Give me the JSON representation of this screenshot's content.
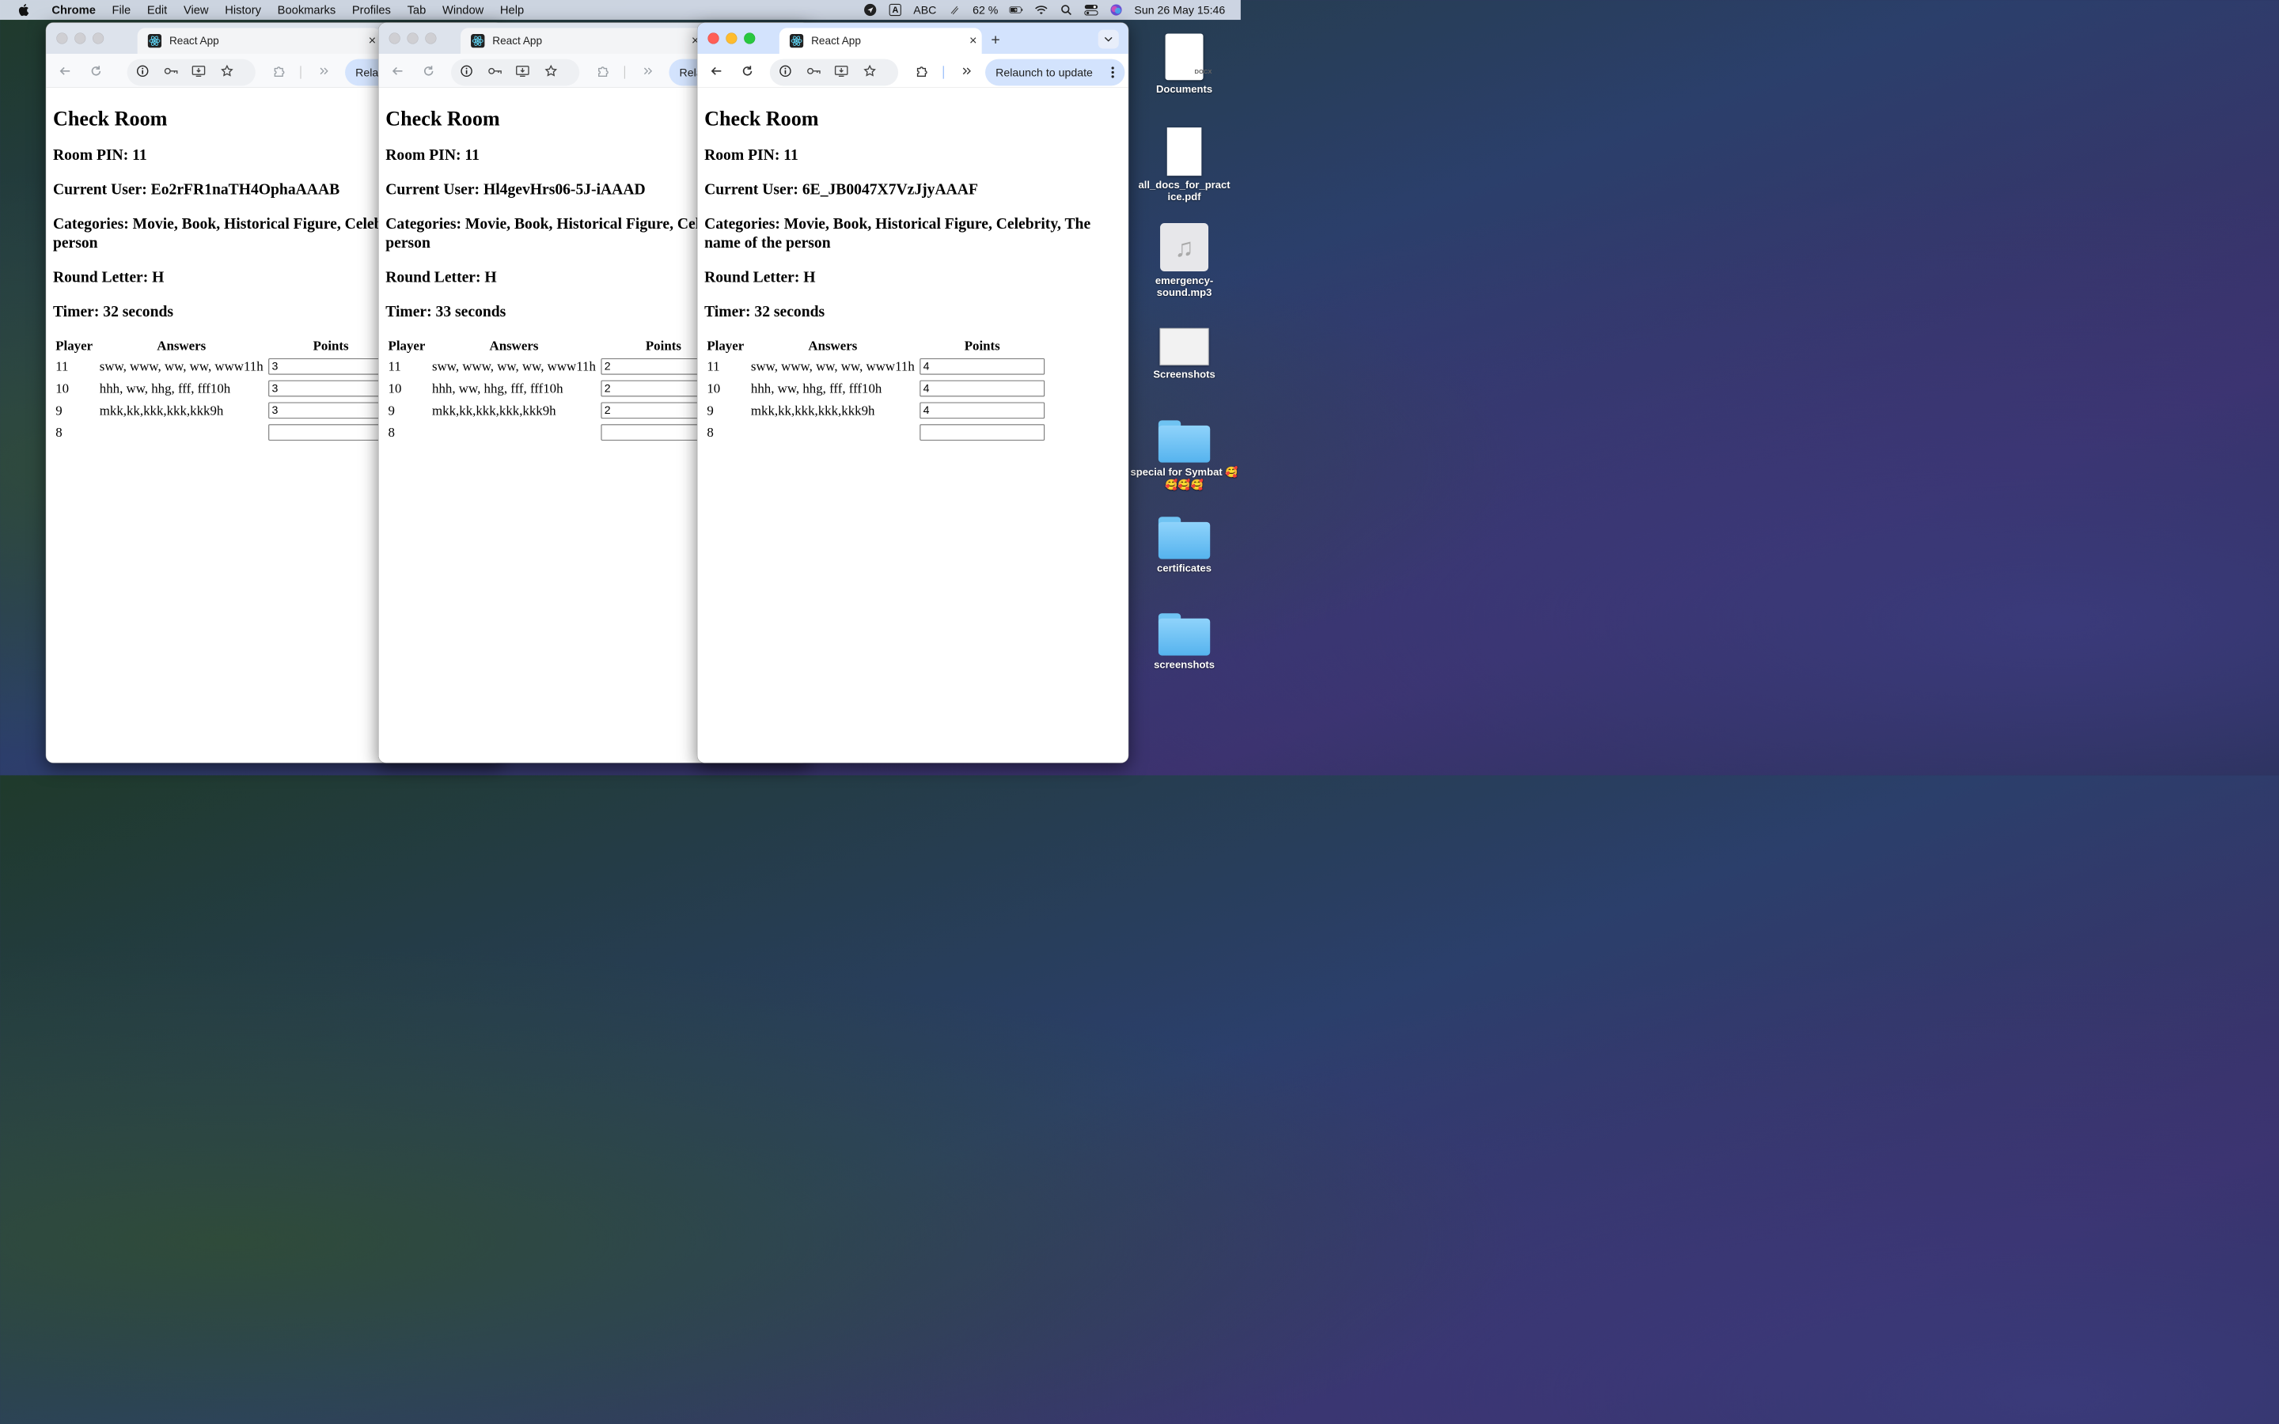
{
  "menubar": {
    "app_name": "Chrome",
    "items": [
      "File",
      "Edit",
      "View",
      "History",
      "Bookmarks",
      "Profiles",
      "Tab",
      "Window",
      "Help"
    ],
    "input_source": "ABC",
    "battery": "62 %",
    "datetime": "Sun 26 May  15:46"
  },
  "desktop": {
    "icons": [
      {
        "label": "Documents",
        "kind": "docx",
        "badge": "DOCX"
      },
      {
        "label": "all_docs_for_pract ice.pdf",
        "kind": "pdf"
      },
      {
        "label": "emergency-sound.mp3",
        "kind": "audio"
      },
      {
        "label": "Screenshots",
        "kind": "screenshot"
      },
      {
        "label": "special for Symbat 🥰🥰🥰🥰",
        "kind": "folder"
      },
      {
        "label": "certificates",
        "kind": "folder"
      },
      {
        "label": "screenshots",
        "kind": "folder"
      }
    ]
  },
  "windows": [
    {
      "tab_title": "React App",
      "relaunch_label": "Relaunch to update",
      "page": {
        "title": "Check Room",
        "room_pin": "Room PIN: 11",
        "current_user": "Current User: Eo2rFR1naTH4OphaAAAB",
        "categories": "Categories: Movie, Book, Historical Figure, Celebrity, The name of the person",
        "round_letter": "Round Letter: H",
        "timer": "Timer: 32 seconds",
        "table_headers": {
          "player": "Player",
          "answers": "Answers",
          "points": "Points"
        },
        "rows": [
          {
            "player": "11",
            "answers": "sww, www, ww, ww, www11h",
            "points": "3"
          },
          {
            "player": "10",
            "answers": "hhh, ww, hhg, fff, fff10h",
            "points": "3"
          },
          {
            "player": "9",
            "answers": "mkk,kk,kkk,kkk,kkk9h",
            "points": "3"
          },
          {
            "player": "8",
            "answers": "",
            "points": ""
          }
        ]
      }
    },
    {
      "tab_title": "React App",
      "relaunch_label": "Relaunch to update",
      "page": {
        "title": "Check Room",
        "room_pin": "Room PIN: 11",
        "current_user": "Current User: Hl4gevHrs06-5J-iAAAD",
        "categories": "Categories: Movie, Book, Historical Figure, Celebrity, The name of the person",
        "round_letter": "Round Letter: H",
        "timer": "Timer: 33 seconds",
        "table_headers": {
          "player": "Player",
          "answers": "Answers",
          "points": "Points"
        },
        "rows": [
          {
            "player": "11",
            "answers": "sww, www, ww, ww, www11h",
            "points": "2"
          },
          {
            "player": "10",
            "answers": "hhh, ww, hhg, fff, fff10h",
            "points": "2"
          },
          {
            "player": "9",
            "answers": "mkk,kk,kkk,kkk,kkk9h",
            "points": "2"
          },
          {
            "player": "8",
            "answers": "",
            "points": ""
          }
        ]
      }
    },
    {
      "tab_title": "React App",
      "relaunch_label": "Relaunch to update",
      "page": {
        "title": "Check Room",
        "room_pin": "Room PIN: 11",
        "current_user": "Current User: 6E_JB0047X7VzJjyAAAF",
        "categories": "Categories: Movie, Book, Historical Figure, Celebrity, The name of the person",
        "round_letter": "Round Letter: H",
        "timer": "Timer: 32 seconds",
        "table_headers": {
          "player": "Player",
          "answers": "Answers",
          "points": "Points"
        },
        "rows": [
          {
            "player": "11",
            "answers": "sww, www, ww, ww, www11h",
            "points": "4"
          },
          {
            "player": "10",
            "answers": "hhh, ww, hhg, fff, fff10h",
            "points": "4"
          },
          {
            "player": "9",
            "answers": "mkk,kk,kkk,kkk,kkk9h",
            "points": "4"
          },
          {
            "player": "8",
            "answers": "",
            "points": ""
          }
        ]
      }
    }
  ],
  "colors": {
    "accent": "#d3e3fd",
    "close": "#ff5f57",
    "minimize": "#febc2e",
    "maximize": "#28c840"
  }
}
